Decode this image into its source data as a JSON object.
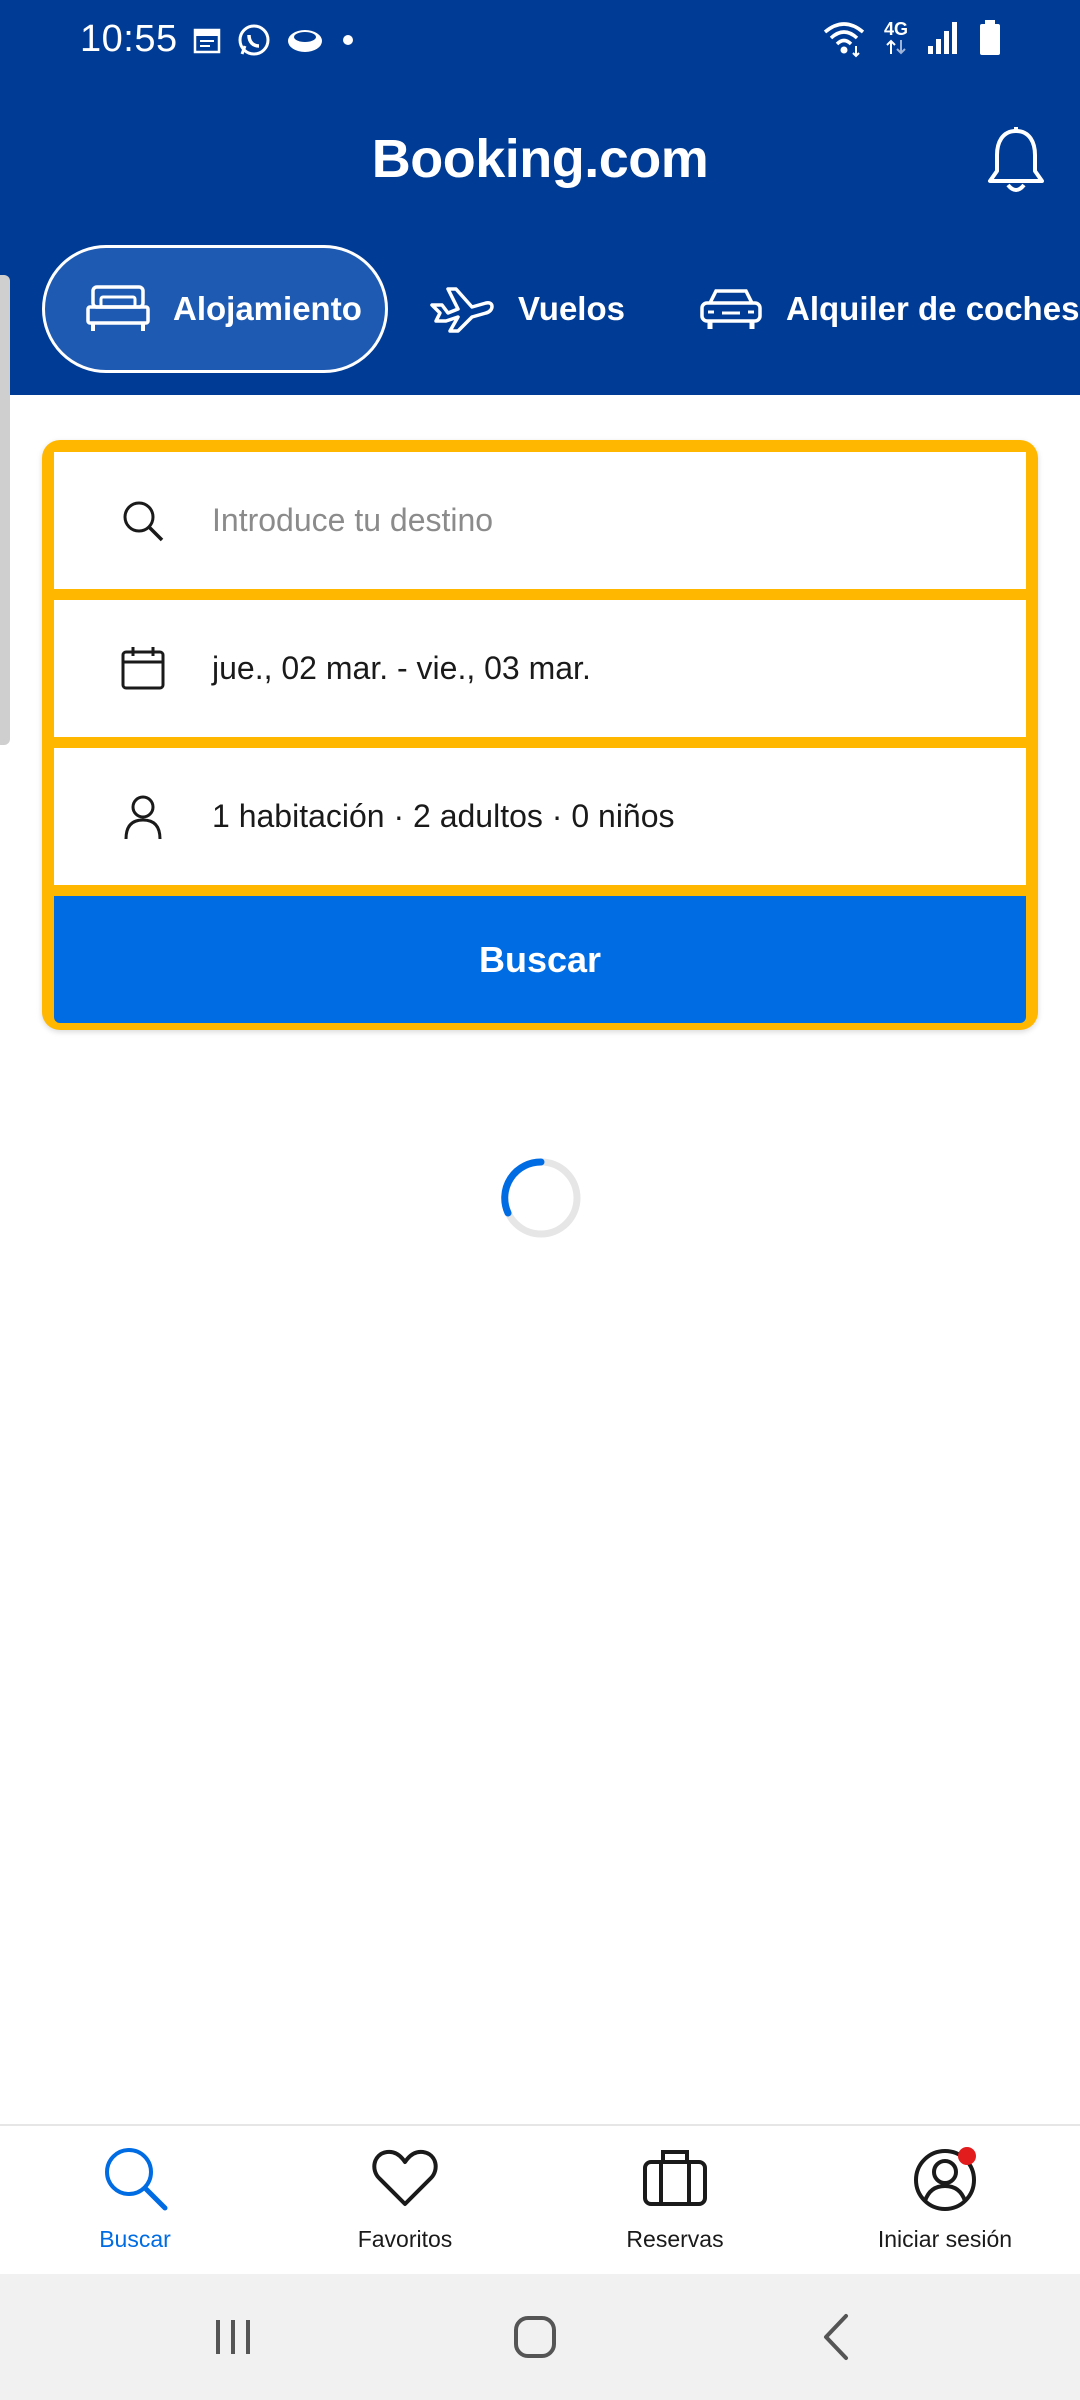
{
  "status_bar": {
    "time": "10:55",
    "network_label": "4G",
    "left_icons": [
      "calendar-icon",
      "whatsapp-icon",
      "cloud-app-icon",
      "dot-icon"
    ],
    "right_icons": [
      "wifi-icon",
      "mobile-data-icon",
      "signal-icon",
      "battery-icon"
    ]
  },
  "header": {
    "brand": "Booking.com",
    "tabs": [
      {
        "label": "Alojamiento",
        "icon": "bed-icon",
        "active": true
      },
      {
        "label": "Vuelos",
        "icon": "plane-icon",
        "active": false
      },
      {
        "label": "Alquiler de coches",
        "icon": "car-icon",
        "active": false
      }
    ]
  },
  "search": {
    "destination_placeholder": "Introduce tu destino",
    "dates": "jue., 02 mar. - vie., 03 mar.",
    "guests": "1 habitación · 2 adultos · 0 niños",
    "button_label": "Buscar"
  },
  "bottom_nav": [
    {
      "label": "Buscar",
      "icon": "search-icon",
      "active": true
    },
    {
      "label": "Favoritos",
      "icon": "heart-icon",
      "active": false
    },
    {
      "label": "Reservas",
      "icon": "suitcase-icon",
      "active": false
    },
    {
      "label": "Iniciar sesión",
      "icon": "account-icon",
      "active": false
    }
  ],
  "colors": {
    "brand_blue": "#003B95",
    "action_blue": "#006CE4",
    "search_border": "#FFB700",
    "notification_dot": "#E21C1C"
  }
}
